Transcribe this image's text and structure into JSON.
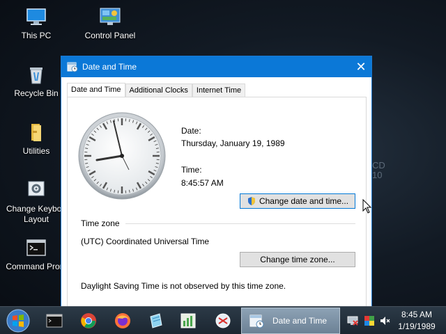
{
  "desktop": {
    "icons": [
      {
        "label": "This PC"
      },
      {
        "label": "Control Panel"
      },
      {
        "label": "Recycle Bin"
      },
      {
        "label": "Utilities"
      },
      {
        "label": "Change Keyboa",
        "label2": "Layout"
      },
      {
        "label": "Command Prom"
      }
    ],
    "wallpaper_text": [
      "CD",
      "10"
    ]
  },
  "window": {
    "title": "Date and Time",
    "close_symbol": "✕",
    "tabs": [
      {
        "label": "Date and Time",
        "active": true
      },
      {
        "label": "Additional Clocks",
        "active": false
      },
      {
        "label": "Internet Time",
        "active": false
      }
    ],
    "date_label": "Date:",
    "date_value": "Thursday, January 19, 1989",
    "time_label": "Time:",
    "time_value": "8:45:57 AM",
    "change_datetime_button": "Change date and time...",
    "timezone_header": "Time zone",
    "timezone_value": "(UTC) Coordinated Universal Time",
    "change_timezone_button": "Change time zone...",
    "dst_note": "Daylight Saving Time is not observed by this time zone."
  },
  "taskbar": {
    "active_task": "Date and Time",
    "time": "8:45 AM",
    "date": "1/19/1989"
  },
  "colors": {
    "titlebar": "#0b78d7",
    "button_focus": "#0078d7",
    "taskbar": "#1b2631"
  }
}
